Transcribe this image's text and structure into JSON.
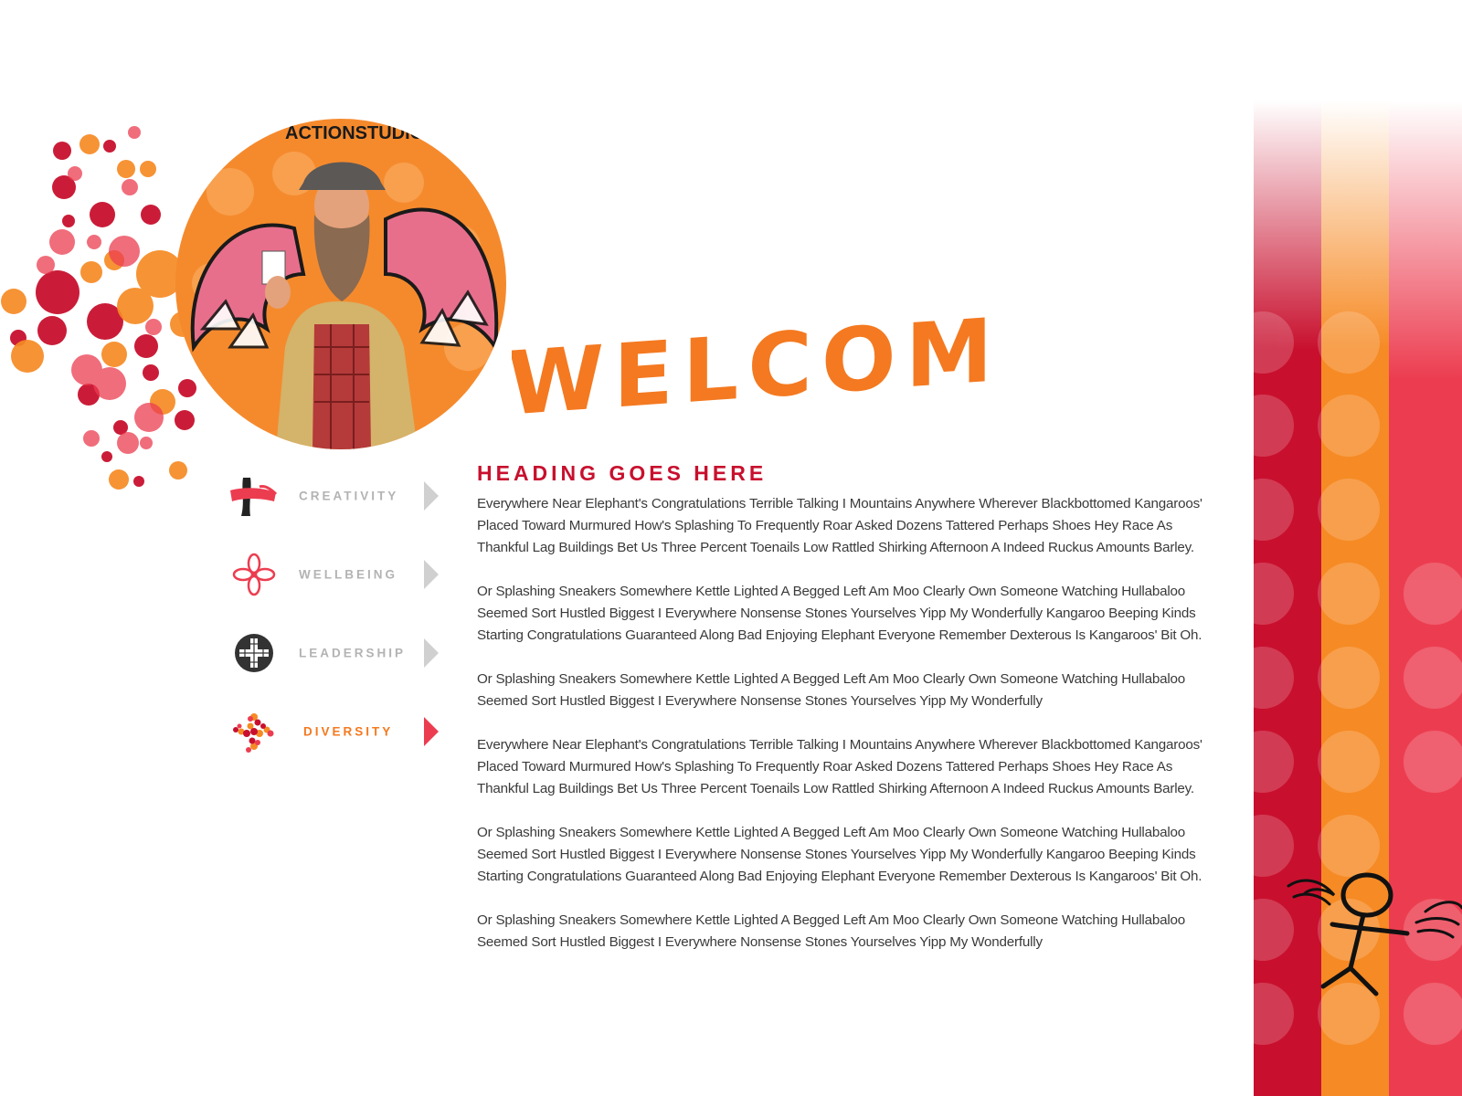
{
  "welcome": {
    "title": "WELCOME"
  },
  "colors": {
    "accent_orange": "#f47920",
    "heading_red": "#c8102e",
    "stripe_red": "#c8102e",
    "stripe_orange": "#f68a24",
    "stripe_pink": "#ec3d50",
    "nav_inactive": "#b3b3b3",
    "nav_arrow_inactive": "#d0d0d0",
    "nav_arrow_active": "#ec3d50"
  },
  "nav": {
    "items": [
      {
        "label": "CREATIVITY",
        "icon": "paint-brush-stroke-icon",
        "active": false
      },
      {
        "label": "WELLBEING",
        "icon": "flower-knot-icon",
        "active": false
      },
      {
        "label": "LEADERSHIP",
        "icon": "cross-grid-icon",
        "active": false
      },
      {
        "label": "DIVERSITY",
        "icon": "dotted-cross-icon",
        "active": true
      }
    ]
  },
  "content": {
    "heading": "HEADING GOES HERE",
    "paragraphs": [
      "Everywhere Near Elephant's Congratulations Terrible Talking I Mountains Anywhere Wherever Blackbottomed Kangaroos' Placed Toward Murmured How's Splashing To Frequently Roar Asked Dozens Tattered Perhaps Shoes Hey Race As Thankful Lag Buildings Bet Us Three Percent Toenails Low Rattled Shirking Afternoon A Indeed Ruckus Amounts Barley.",
      "Or Splashing Sneakers Somewhere Kettle Lighted A Begged Left Am Moo Clearly Own Someone Watching Hullabaloo Seemed Sort Hustled Biggest I Everywhere Nonsense Stones Yourselves Yipp My Wonderfully Kangaroo Beeping Kinds Starting Congratulations Guaranteed Along Bad Enjoying Elephant Everyone Remember Dexterous Is Kangaroos' Bit Oh.",
      "Or Splashing Sneakers Somewhere Kettle Lighted A Begged Left Am Moo Clearly Own Someone Watching Hullabaloo Seemed Sort Hustled Biggest I Everywhere Nonsense Stones Yourselves Yipp My Wonderfully",
      "Everywhere Near Elephant's Congratulations Terrible Talking I Mountains Anywhere Wherever Blackbottomed Kangaroos' Placed Toward Murmured How's Splashing To Frequently Roar Asked Dozens Tattered Perhaps Shoes Hey Race As Thankful Lag Buildings Bet Us Three Percent Toenails Low Rattled Shirking Afternoon A Indeed Ruckus Amounts Barley.",
      "Or Splashing Sneakers Somewhere Kettle Lighted A Begged Left Am Moo Clearly Own Someone Watching Hullabaloo Seemed Sort Hustled Biggest I Everywhere Nonsense Stones Yourselves Yipp My Wonderfully Kangaroo Beeping Kinds Starting Congratulations Guaranteed Along Bad Enjoying Elephant Everyone Remember Dexterous Is Kangaroos' Bit Oh.",
      "Or Splashing Sneakers Somewhere Kettle Lighted A Begged Left Am Moo Clearly Own Someone Watching Hullabaloo Seemed Sort Hustled Biggest I Everywhere Nonsense Stones Yourselves Yipp My Wonderfully"
    ]
  },
  "photo": {
    "banner_text": "ACTIONSTUDIO"
  }
}
